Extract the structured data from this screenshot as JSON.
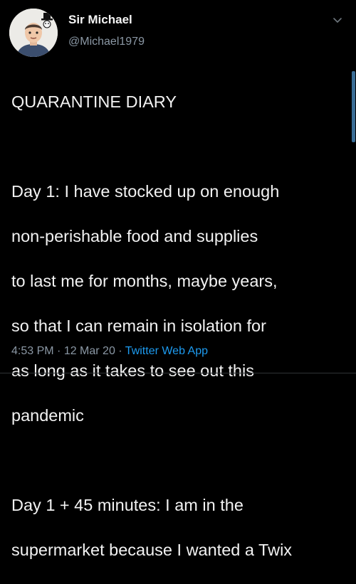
{
  "author": {
    "name": "Sir Michael",
    "handle": "@Michael1979",
    "avatar_icon": "cartoon-portrait-with-top-hat"
  },
  "tweet": {
    "lines": [
      "QUARANTINE DIARY",
      "",
      "Day 1: I have stocked up on enough",
      "non-perishable food and supplies",
      "to last me for months, maybe years,",
      "so that I can remain in isolation for",
      "as long as it takes to see out this",
      "pandemic",
      "",
      "Day 1 + 45 minutes: I am in the",
      "supermarket because I wanted a Twix"
    ]
  },
  "meta": {
    "time": "4:53 PM",
    "separator_1": " · ",
    "date": "12 Mar 20",
    "separator_2": " · ",
    "app": "Twitter Web App"
  },
  "menu": {
    "icon": "chevron-down-icon"
  },
  "colors": {
    "background": "#000000",
    "text": "#f2f2f2",
    "secondary_text": "#8b98a5",
    "link": "#1d9bf0"
  }
}
